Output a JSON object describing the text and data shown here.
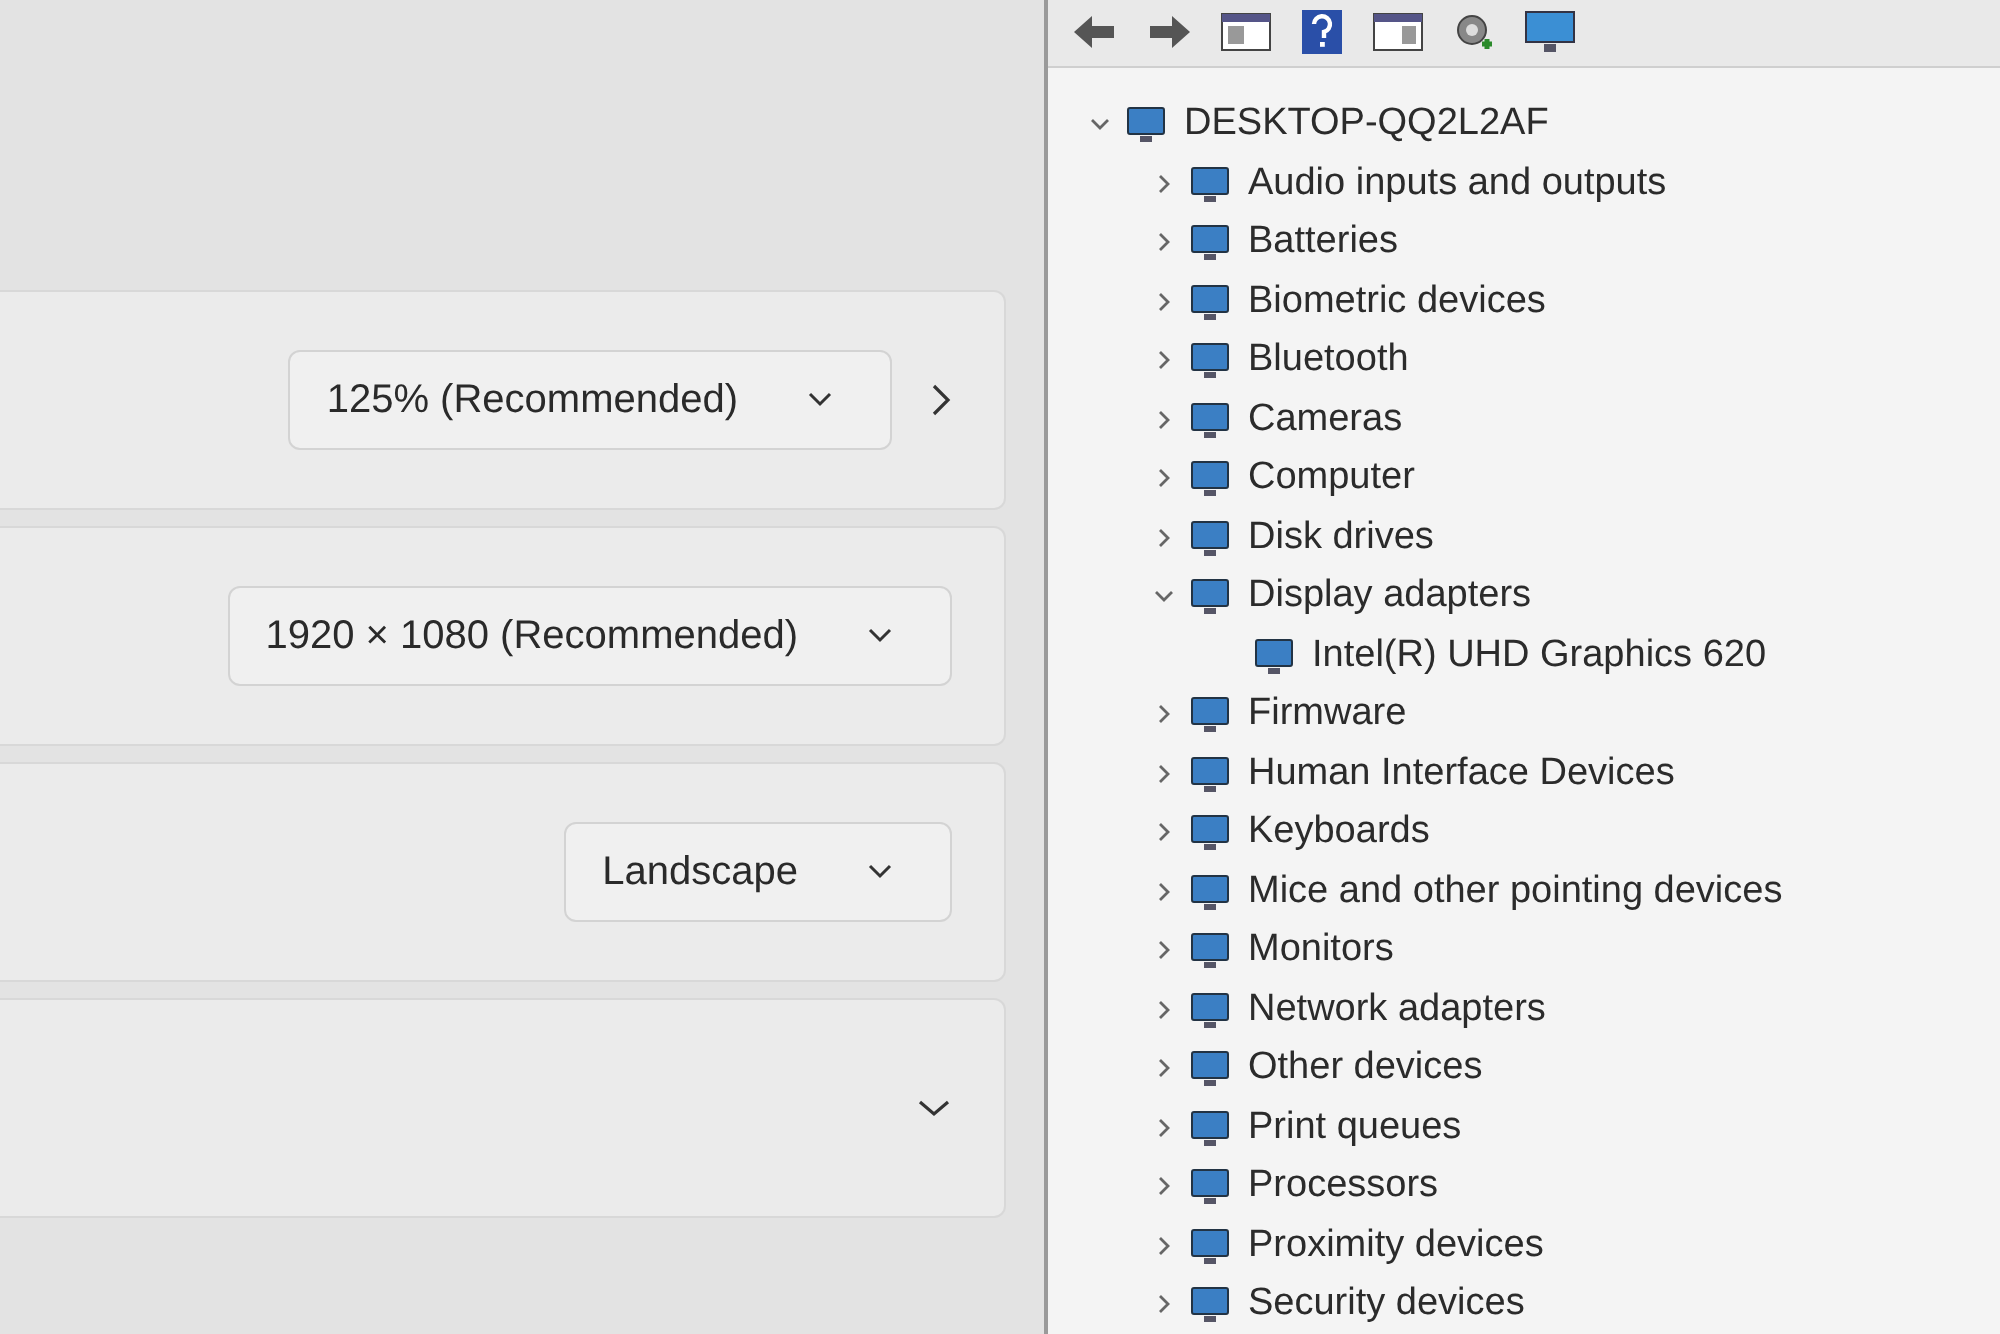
{
  "settings_cards": [
    {
      "kind": "link",
      "dropdown": "125% (Recommended)"
    },
    {
      "kind": "plain",
      "dropdown": "1920 × 1080 (Recommended)"
    },
    {
      "kind": "plain",
      "dropdown": "Landscape"
    },
    {
      "kind": "expander",
      "expanded": false
    }
  ],
  "device_tree": {
    "label": "DESKTOP-QQ2L2AF",
    "expanded": true,
    "children": [
      {
        "label": "Audio inputs and outputs",
        "expanded": false
      },
      {
        "label": "Batteries",
        "expanded": false
      },
      {
        "label": "Biometric devices",
        "expanded": false
      },
      {
        "label": "Bluetooth",
        "expanded": false
      },
      {
        "label": "Cameras",
        "expanded": false
      },
      {
        "label": "Computer",
        "expanded": false
      },
      {
        "label": "Disk drives",
        "expanded": false
      },
      {
        "label": "Display adapters",
        "expanded": true,
        "children": [
          {
            "label": "Intel(R) UHD Graphics 620"
          }
        ]
      },
      {
        "label": "Firmware",
        "expanded": false
      },
      {
        "label": "Human Interface Devices",
        "expanded": false
      },
      {
        "label": "Keyboards",
        "expanded": false
      },
      {
        "label": "Mice and other pointing devices",
        "expanded": false
      },
      {
        "label": "Monitors",
        "expanded": false
      },
      {
        "label": "Network adapters",
        "expanded": false
      },
      {
        "label": "Other devices",
        "expanded": false
      },
      {
        "label": "Print queues",
        "expanded": false
      },
      {
        "label": "Processors",
        "expanded": false
      },
      {
        "label": "Proximity devices",
        "expanded": false
      },
      {
        "label": "Security devices",
        "expanded": false
      }
    ]
  }
}
